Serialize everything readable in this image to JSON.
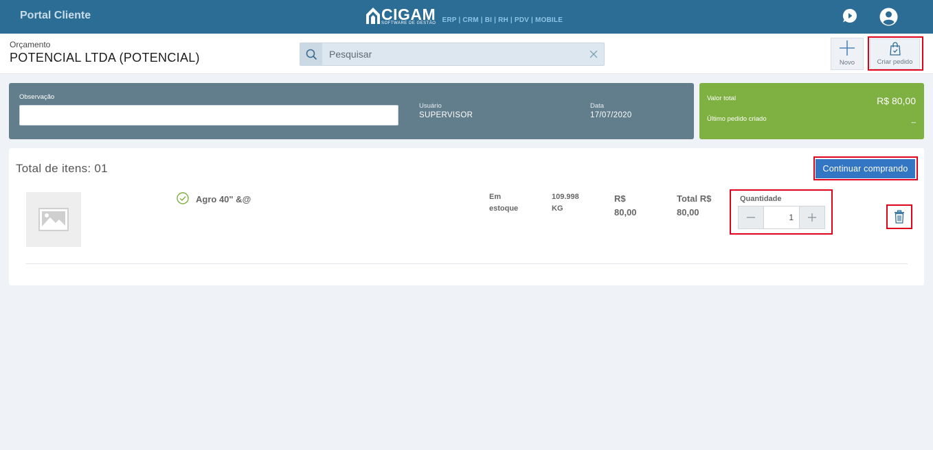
{
  "header": {
    "portal_title": "Portal Cliente",
    "logo_name": "CIGAM",
    "logo_sub": "SOFTWARE DE GESTÃO",
    "logo_modules": "ERP | CRM | BI | RH | PDV | MOBILE",
    "brand_color": "#2b6d94"
  },
  "subheader": {
    "label": "Orçamento",
    "title": "POTENCIAL LTDA (POTENCIAL)",
    "search_placeholder": "Pesquisar",
    "novo_label": "Novo",
    "criar_label": "Criar pedido"
  },
  "info": {
    "observacao_label": "Observação",
    "observacao_value": "",
    "usuario_label": "Usuário",
    "usuario_value": "SUPERVISOR",
    "data_label": "Data",
    "data_value": "17/07/2020"
  },
  "totals": {
    "valor_total_label": "Valor total",
    "valor_total_value": "R$ 80,00",
    "ultimo_pedido_label": "Último pedido criado",
    "ultimo_pedido_value": "_"
  },
  "items": {
    "title": "Total de itens: 01",
    "continue_label": "Continuar comprando",
    "list": [
      {
        "name": "Agro 40\" &@",
        "stock_line1": "Em",
        "stock_line2": "estoque",
        "qty_stock_line1": "109.998",
        "qty_stock_line2": "KG",
        "price_line1": "R$",
        "price_line2": "80,00",
        "total_line1": "Total R$",
        "total_line2": "80,00",
        "quantity_label": "Quantidade",
        "quantity_value": "1"
      }
    ]
  },
  "icons": {
    "search": "search-icon",
    "clear": "close-icon",
    "chat": "chat-icon",
    "user": "user-avatar-icon",
    "novo": "plus-icon",
    "criar": "shopping-bag-icon",
    "check": "check-circle-icon",
    "trash": "trash-icon",
    "image": "image-placeholder-icon"
  }
}
